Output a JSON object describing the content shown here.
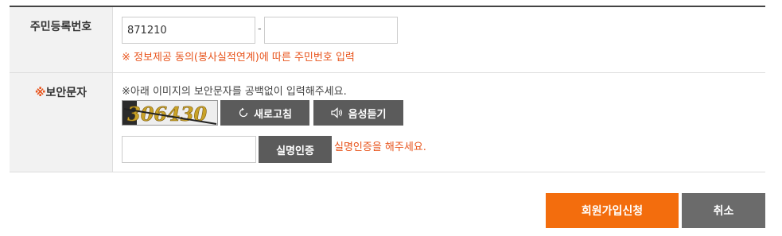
{
  "resident_row": {
    "label": "주민등록번호",
    "front_value": "871210",
    "separator": "-",
    "back_value": "",
    "notice": "※ 정보제공 동의(봉사실적연계)에 따른 주민번호 입력"
  },
  "captcha_row": {
    "label_mark": "※",
    "label": "보안문자",
    "instruction": "※아래 이미지의 보안문자를 공백없이 입력해주세요.",
    "captcha_text": "306430",
    "refresh_label": "새로고침",
    "listen_label": "음성듣기",
    "input_value": "",
    "verify_label": "실명인증",
    "verify_notice": "실명인증을 해주세요."
  },
  "actions": {
    "submit_label": "회원가입신청",
    "cancel_label": "취소"
  },
  "colors": {
    "accent_orange": "#f36d0d",
    "notice_orange": "#e8541c",
    "button_grey": "#5b5b5b",
    "cancel_grey": "#6b6b6b",
    "header_bg": "#f2f2f2"
  },
  "icons": {
    "refresh": "refresh-icon",
    "speaker": "speaker-icon"
  }
}
